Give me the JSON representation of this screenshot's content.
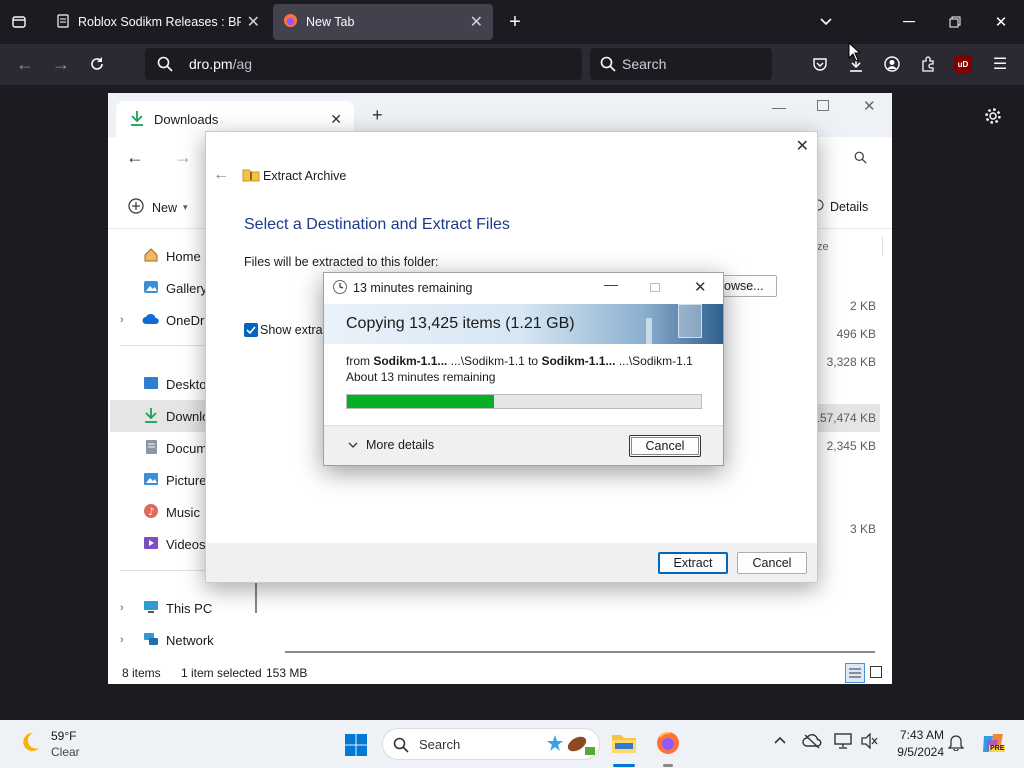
{
  "browser": {
    "tabs": [
      {
        "title": "Roblox Sodikm Releases : BRAV",
        "active": false
      },
      {
        "title": "New Tab",
        "active": true
      }
    ],
    "url_host": "dro.pm",
    "url_path": "/ag",
    "search_placeholder": "Search",
    "addon_badge": "uD"
  },
  "explorer": {
    "tab_title": "Downloads",
    "new_label": "New",
    "details_label": "Details",
    "size_header": "ze",
    "nav": [
      {
        "label": "Home",
        "icon": "home-icon"
      },
      {
        "label": "Gallery",
        "icon": "gallery-icon"
      },
      {
        "label": "OneDriv",
        "icon": "cloud-icon"
      },
      {
        "label": "Desktop",
        "icon": "desktop-icon"
      },
      {
        "label": "Downloa",
        "icon": "download-icon"
      },
      {
        "label": "Docume",
        "icon": "document-icon"
      },
      {
        "label": "Pictures",
        "icon": "pictures-icon"
      },
      {
        "label": "Music",
        "icon": "music-icon"
      },
      {
        "label": "Videos",
        "icon": "videos-icon"
      },
      {
        "label": "This PC",
        "icon": "pc-icon"
      },
      {
        "label": "Network",
        "icon": "network-icon"
      }
    ],
    "sizes": [
      "2 KB",
      "496 KB",
      "3,328 KB",
      "157,474 KB",
      "2,345 KB",
      "3 KB"
    ],
    "status": {
      "items": "8 items",
      "selected": "1 item selected",
      "size": "153 MB"
    }
  },
  "extract": {
    "title": "Extract Archive",
    "heading": "Select a Destination and Extract Files",
    "folder_label": "Files will be extracted to this folder:",
    "browse_label": "owse...",
    "show_label": "Show extrac",
    "extract_btn": "Extract",
    "cancel_btn": "Cancel"
  },
  "copy": {
    "title": "13 minutes remaining",
    "banner": "Copying 13,425 items (1.21 GB)",
    "from_word": "from",
    "from_name": "Sodikm-1.1...",
    "from_path": "...\\Sodikm-1.1",
    "to_word": "to",
    "to_name": "Sodikm-1.1...",
    "to_path": "...\\Sodikm-1.1",
    "remaining": "About 13 minutes remaining",
    "progress": 0.415,
    "more_details": "More details",
    "cancel": "Cancel"
  },
  "taskbar": {
    "temp": "59°F",
    "weather": "Clear",
    "search": "Search",
    "time": "7:43 AM",
    "date": "9/5/2024",
    "copilot_badge": "PRE"
  }
}
